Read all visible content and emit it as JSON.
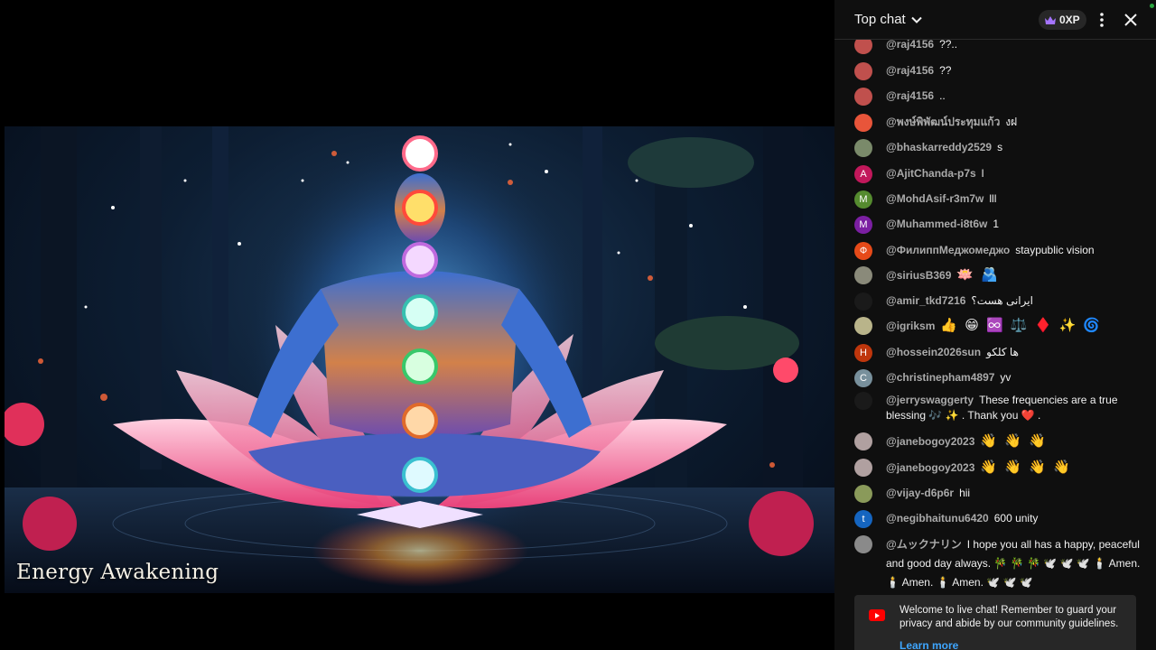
{
  "video": {
    "title": "Energy Awakening"
  },
  "chat": {
    "mode_label": "Top chat",
    "xp_label": "0XP",
    "live_color": "#2ba640",
    "messages": [
      {
        "author": "@raj4156",
        "text": "??..",
        "avatar_color": "#c0504d",
        "avatar_letter": ""
      },
      {
        "author": "@raj4156",
        "text": "??",
        "avatar_color": "#c0504d",
        "avatar_letter": ""
      },
      {
        "author": "@raj4156",
        "text": "..",
        "avatar_color": "#c0504d",
        "avatar_letter": ""
      },
      {
        "author": "@พงษ์พิพัฒน์ประทุมแก้ว",
        "text": "งฝ",
        "avatar_color": "#e8553a",
        "avatar_letter": ""
      },
      {
        "author": "@bhaskarreddy2529",
        "text": "s",
        "avatar_color": "#7a8a6a",
        "avatar_letter": ""
      },
      {
        "author": "@AjitChanda-p7s",
        "text": "l",
        "avatar_color": "#c2185b",
        "avatar_letter": "A"
      },
      {
        "author": "@MohdAsif-r3m7w",
        "text": "lll",
        "avatar_color": "#558b2f",
        "avatar_letter": "M"
      },
      {
        "author": "@Muhammed-i8t6w",
        "text": "1",
        "avatar_color": "#7b1fa2",
        "avatar_letter": "M"
      },
      {
        "author": "@ФилиппМеджомеджо",
        "text": "staypublic vision",
        "avatar_color": "#e64a19",
        "avatar_letter": "Ф"
      },
      {
        "author": "@siriusB369",
        "text": "🪷 🫂",
        "avatar_color": "#8a8a7a",
        "avatar_letter": ""
      },
      {
        "author": "@amir_tkd7216",
        "text": "ایرانی هست؟",
        "avatar_color": "#1a1a1a",
        "avatar_letter": ""
      },
      {
        "author": "@igriksm",
        "text": "👍 😁 ♾️ ⚖️ ♦️ ✨ 🌀",
        "avatar_color": "#b9b48a",
        "avatar_letter": ""
      },
      {
        "author": "@hossein2026sun",
        "text": "ها کلکو",
        "avatar_color": "#bf360c",
        "avatar_letter": "H"
      },
      {
        "author": "@christinepham4897",
        "text": "yv",
        "avatar_color": "#78909c",
        "avatar_letter": "C"
      },
      {
        "author": "@jerryswaggerty",
        "text": "These frequencies are a true blessing 🎶 ✨ . Thank you ❤️ .",
        "avatar_color": "#1a1a1a",
        "avatar_letter": ""
      },
      {
        "author": "@janebogoy2023",
        "text": "👋 👋 👋",
        "avatar_color": "#b0a0a0",
        "avatar_letter": ""
      },
      {
        "author": "@janebogoy2023",
        "text": "👋 👋 👋 👋",
        "avatar_color": "#b0a0a0",
        "avatar_letter": ""
      },
      {
        "author": "@vijay-d6p6r",
        "text": "hii",
        "avatar_color": "#8a9a5a",
        "avatar_letter": ""
      },
      {
        "author": "@negibhaitunu6420",
        "text": "600 unity",
        "avatar_color": "#1565c0",
        "avatar_letter": "t"
      },
      {
        "author": "@ムックナリン",
        "text": "I hope you all has a happy, peaceful and good day always. 🎋 🎋 🎋 🕊️ 🕊️ 🕊️ 🕯️ Amen. 🕯️ Amen. 🕯️ Amen. 🕊️ 🕊️ 🕊️",
        "avatar_color": "#8a8a8a",
        "avatar_letter": ""
      }
    ],
    "welcome": {
      "text": "Welcome to live chat! Remember to guard your privacy and abide by our community guidelines.",
      "learn_more": "Learn more"
    }
  }
}
